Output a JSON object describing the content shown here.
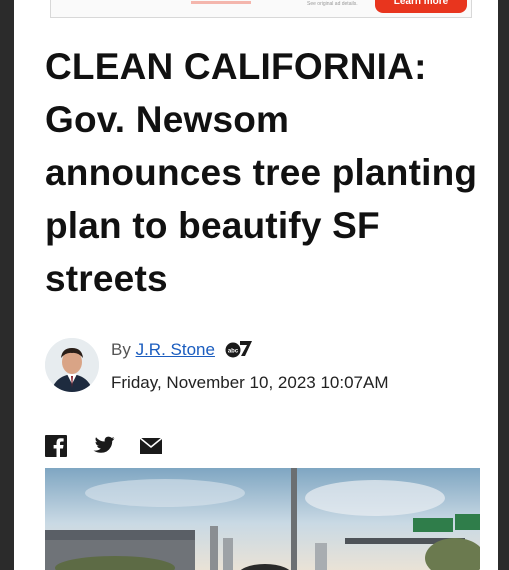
{
  "ad": {
    "fine_print": "See original ad details.",
    "button_label": "Learn more"
  },
  "article": {
    "headline": "CLEAN CALIFORNIA: Gov. Newsom announces tree planting plan to beautify SF streets",
    "byline_prefix": "By",
    "author": "J.R. Stone",
    "date": "Friday, November 10, 2023 10:07AM"
  },
  "share": {
    "icons": [
      "facebook-icon",
      "twitter-icon",
      "email-icon"
    ]
  },
  "colors": {
    "link": "#1b5dbf",
    "ad_button": "#e8351e",
    "headline": "#111111"
  }
}
